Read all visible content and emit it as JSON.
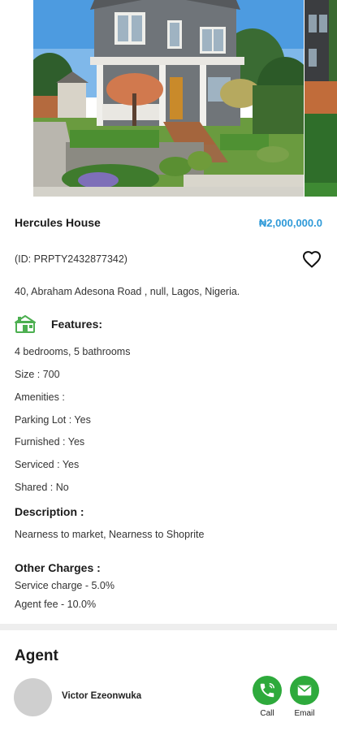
{
  "property": {
    "title": "Hercules House",
    "price": "₦2,000,000.0",
    "id_text": "(ID: PRPTY2432877342)",
    "address": "40, Abraham Adesona Road , null, Lagos, Nigeria."
  },
  "features": {
    "heading": "Features:",
    "items": [
      "4 bedrooms, 5 bathrooms",
      "Size : 700",
      "Amenities :",
      "Parking Lot : Yes",
      "Furnished : Yes",
      "Serviced : Yes",
      "Shared : No"
    ]
  },
  "description": {
    "heading": "Description :",
    "text": "Nearness to market, Nearness to Shoprite"
  },
  "other_charges": {
    "heading": "Other Charges :",
    "items": [
      "Service charge  -  5.0%",
      "Agent fee  -  10.0%"
    ]
  },
  "agent": {
    "heading": "Agent",
    "name": "Victor Ezeonwuka",
    "call_label": "Call",
    "email_label": "Email"
  },
  "icons": {
    "favorite": "heart-outline-icon",
    "features": "house-icon",
    "call": "phone-icon",
    "email": "mail-icon"
  },
  "colors": {
    "price": "#2f9ad8",
    "action_green": "#2eaa3c",
    "feature_icon": "#4caf50",
    "divider": "#eeeeee"
  }
}
